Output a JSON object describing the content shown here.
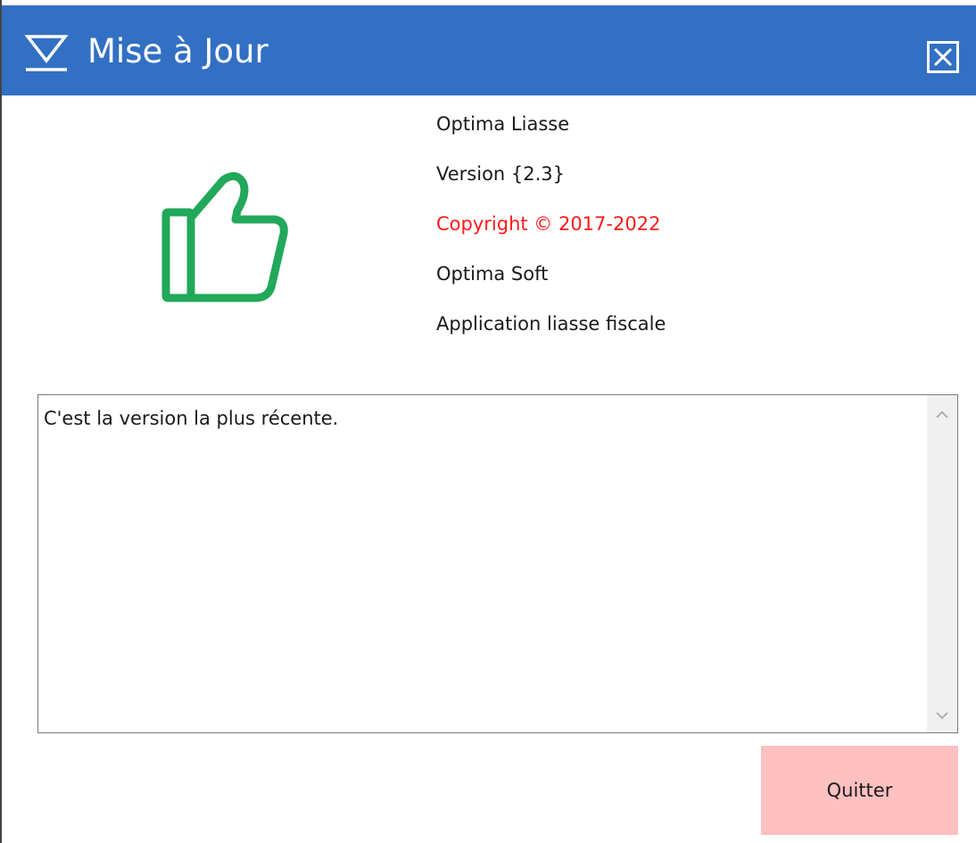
{
  "window": {
    "title": "Mise à Jour",
    "title_icon": "download-tray-icon",
    "close_icon": "close-icon"
  },
  "app_info": {
    "icon": "thumbs-up-icon",
    "product_name": "Optima Liasse",
    "version": "Version {2.3}",
    "copyright": "Copyright © 2017-2022",
    "company": "Optima Soft",
    "description": "Application liasse fiscale"
  },
  "message_box": {
    "text": "C'est la version la plus récente."
  },
  "buttons": {
    "quit_label": "Quitter"
  },
  "colors": {
    "titlebar": "#3270c3",
    "thumbs_up": "#22a85a",
    "copyright": "#ff1a1a",
    "quit_button": "#ffc0c0"
  }
}
